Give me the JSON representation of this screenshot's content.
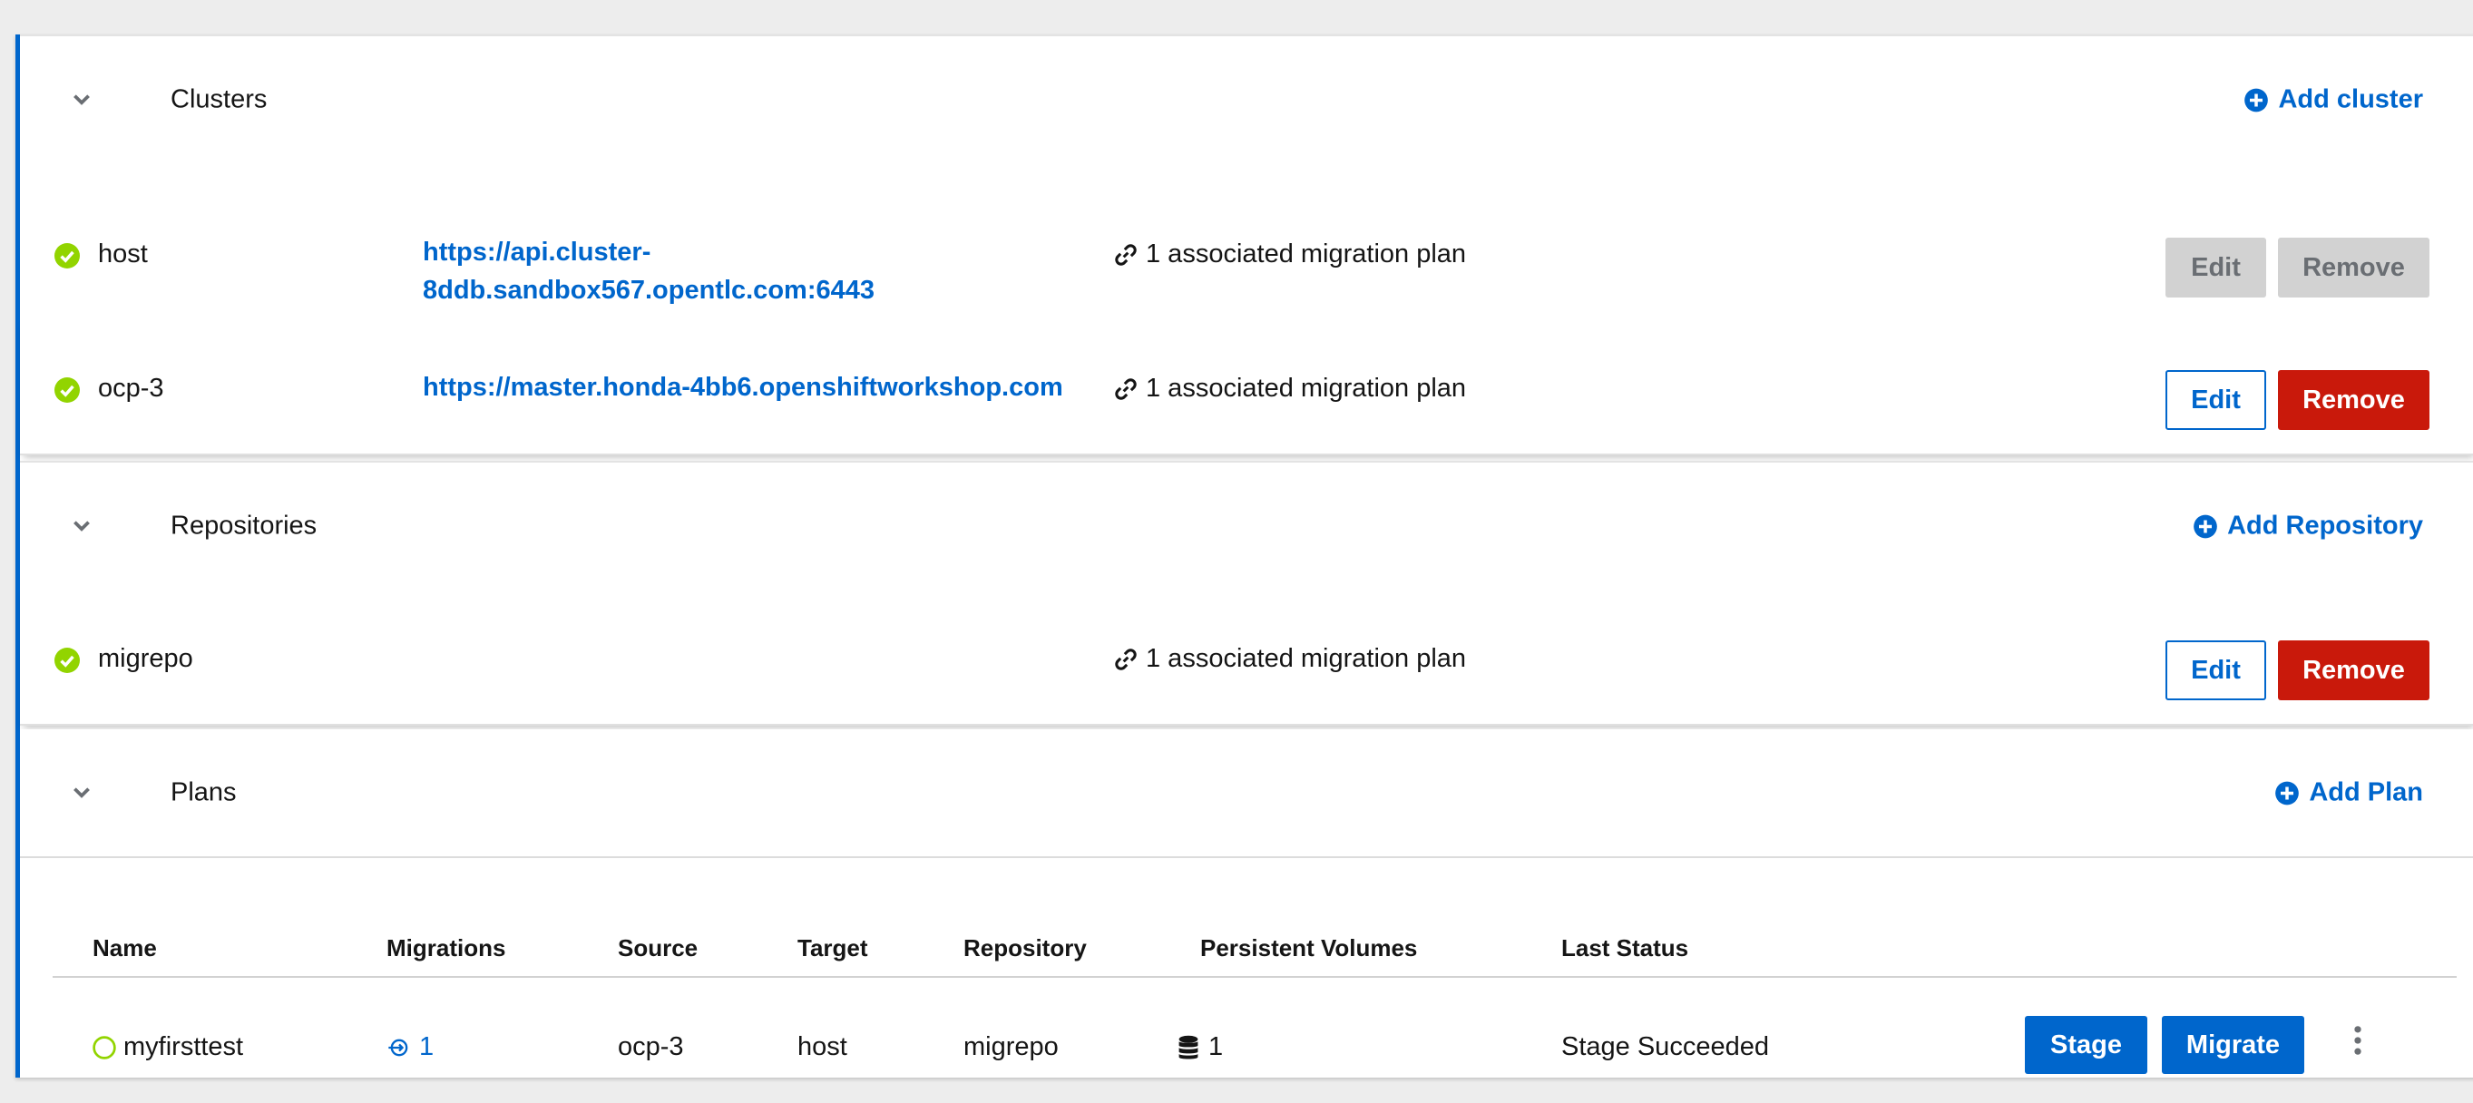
{
  "clusters": {
    "title": "Clusters",
    "add_label": "Add cluster",
    "items": [
      {
        "name": "host",
        "url_line1": "https://api.cluster-",
        "url_line2": "8ddb.sandbox567.opentlc.com:6443",
        "assoc": "1 associated migration plan",
        "edit_label": "Edit",
        "remove_label": "Remove",
        "actions_disabled": true
      },
      {
        "name": "ocp-3",
        "url": "https://master.honda-4bb6.openshiftworkshop.com",
        "assoc": "1 associated migration plan",
        "edit_label": "Edit",
        "remove_label": "Remove"
      }
    ]
  },
  "repositories": {
    "title": "Repositories",
    "add_label": "Add Repository",
    "items": [
      {
        "name": "migrepo",
        "assoc": "1 associated migration plan",
        "edit_label": "Edit",
        "remove_label": "Remove"
      }
    ]
  },
  "plans": {
    "title": "Plans",
    "add_label": "Add Plan",
    "columns": [
      "Name",
      "Migrations",
      "Source",
      "Target",
      "Repository",
      "Persistent Volumes",
      "Last Status"
    ],
    "rows": [
      {
        "name": "myfirsttest",
        "migrations": "1",
        "source": "ocp-3",
        "target": "host",
        "repository": "migrepo",
        "persistent_volumes": "1",
        "last_status": "Stage Succeeded",
        "stage_label": "Stage",
        "migrate_label": "Migrate"
      }
    ]
  },
  "colors": {
    "accent": "#0066cc",
    "danger": "#c9190b",
    "success": "#3e8635",
    "success_icon": "#92d400",
    "disabled": "#d2d2d2"
  }
}
